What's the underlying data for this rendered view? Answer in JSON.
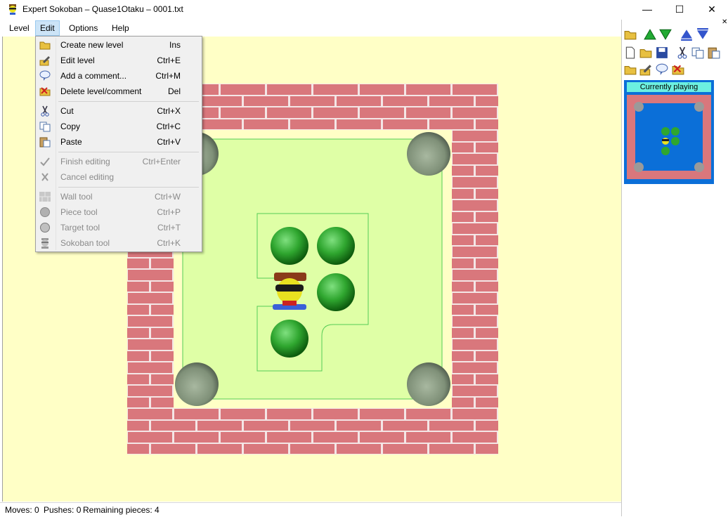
{
  "window": {
    "title": "Expert Sokoban – Quase1Otaku – 0001.txt",
    "minimize": "—",
    "maximize": "☐",
    "close": "✕"
  },
  "menubar": {
    "level": "Level",
    "edit": "Edit",
    "options": "Options",
    "help": "Help"
  },
  "edit_menu": [
    {
      "label": "Create new level",
      "shortcut": "Ins",
      "icon": "new-folder-icon",
      "enabled": true
    },
    {
      "label": "Edit level",
      "shortcut": "Ctrl+E",
      "icon": "edit-pencil-icon",
      "enabled": true
    },
    {
      "label": "Add a comment...",
      "shortcut": "Ctrl+M",
      "icon": "comment-balloon-icon",
      "enabled": true
    },
    {
      "label": "Delete level/comment",
      "shortcut": "Del",
      "icon": "delete-folder-icon",
      "enabled": true
    },
    {
      "label": "Cut",
      "shortcut": "Ctrl+X",
      "icon": "scissors-icon",
      "enabled": true
    },
    {
      "label": "Copy",
      "shortcut": "Ctrl+C",
      "icon": "copy-icon",
      "enabled": true
    },
    {
      "label": "Paste",
      "shortcut": "Ctrl+V",
      "icon": "paste-icon",
      "enabled": true
    },
    {
      "label": "Finish editing",
      "shortcut": "Ctrl+Enter",
      "icon": "checkmark-icon",
      "enabled": false
    },
    {
      "label": "Cancel editing",
      "shortcut": "",
      "icon": "cross-icon",
      "enabled": false
    },
    {
      "label": "Wall tool",
      "shortcut": "Ctrl+W",
      "icon": "wall-icon",
      "enabled": false
    },
    {
      "label": "Piece tool",
      "shortcut": "Ctrl+P",
      "icon": "piece-icon",
      "enabled": false
    },
    {
      "label": "Target tool",
      "shortcut": "Ctrl+T",
      "icon": "target-icon",
      "enabled": false
    },
    {
      "label": "Sokoban tool",
      "shortcut": "Ctrl+K",
      "icon": "sokoban-icon",
      "enabled": false
    }
  ],
  "status": {
    "moves": "Moves: 0",
    "pushes": "Pushes: 0",
    "remaining": "Remaining pieces: 4"
  },
  "side_panel": {
    "currently_playing": "Currently playing",
    "close_glyph": "✕"
  },
  "colors": {
    "background": "#ffffc6",
    "floor": "#dfffa6",
    "brick": "#d9777c",
    "piece": "#2fa62f",
    "panel_blue": "#0b6fd8",
    "highlight": "#6cf0e0"
  }
}
